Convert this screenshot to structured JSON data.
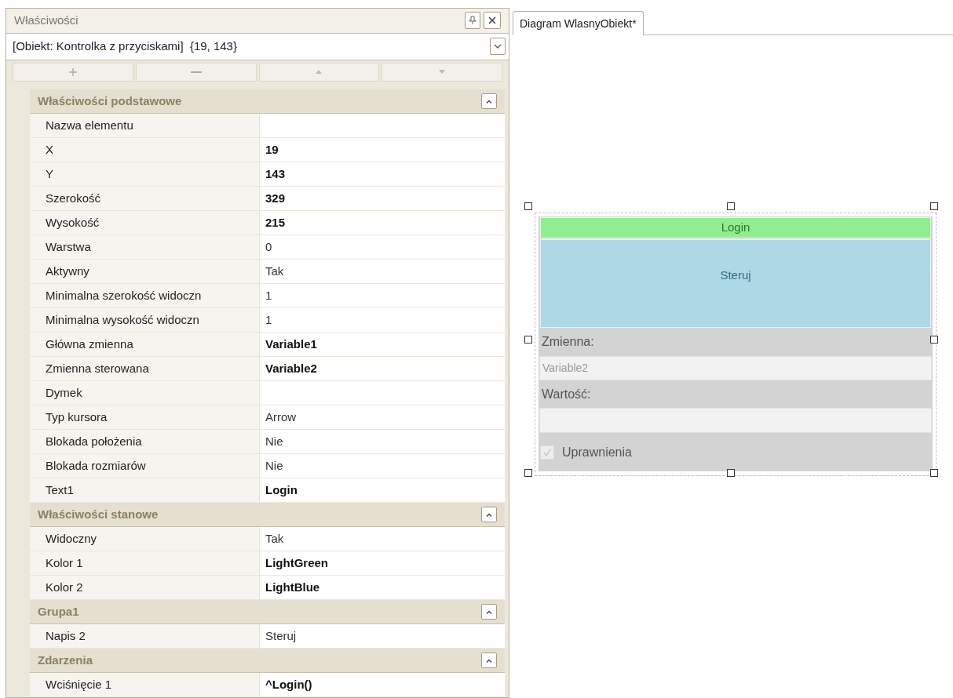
{
  "properties_panel": {
    "title": "Właściwości",
    "object_selector": "[Obiekt: Kontrolka z przyciskami]  {19, 143}",
    "sections": [
      {
        "title": "Właściwości podstawowe",
        "expanded": true,
        "rows": [
          {
            "name": "Nazwa elementu"
          },
          {
            "name": "X",
            "value": "19",
            "bold": true
          },
          {
            "name": "Y",
            "value": "143",
            "bold": true
          },
          {
            "name": "Szerokość",
            "value": "329",
            "bold": true
          },
          {
            "name": "Wysokość",
            "value": "215",
            "bold": true
          },
          {
            "name": "Warstwa",
            "value": "0",
            "bold": false
          },
          {
            "name": "Aktywny",
            "value": "Tak",
            "bold": false
          },
          {
            "name": "Minimalna szerokość widoczn",
            "value": "1",
            "bold": false
          },
          {
            "name": "Minimalna wysokość widoczn",
            "value": "1",
            "bold": false
          },
          {
            "name": "Główna zmienna",
            "value": "Variable1",
            "bold": true
          },
          {
            "name": "Zmienna sterowana",
            "value": "Variable2",
            "bold": true
          },
          {
            "name": "Dymek"
          },
          {
            "name": "Typ kursora",
            "value": "Arrow",
            "bold": false
          },
          {
            "name": "Blokada położenia",
            "value": "Nie",
            "bold": false
          },
          {
            "name": "Blokada rozmiarów",
            "value": "Nie",
            "bold": false
          },
          {
            "name": "Text1",
            "value": "Login",
            "bold": true
          }
        ]
      },
      {
        "title": "Właściwości stanowe",
        "expanded": true,
        "rows": [
          {
            "name": "Widoczny",
            "value": "Tak",
            "bold": false
          },
          {
            "name": "Kolor 1",
            "value": "LightGreen",
            "bold": true
          },
          {
            "name": "Kolor 2",
            "value": "LightBlue",
            "bold": true
          }
        ]
      },
      {
        "title": "Grupa1",
        "expanded": true,
        "rows": [
          {
            "name": "Napis 2",
            "value": "Steruj",
            "bold": false
          }
        ]
      },
      {
        "title": "Zdarzenia",
        "expanded": true,
        "rows": [
          {
            "name": "Wciśnięcie 1",
            "value": "^Login()",
            "bold": true
          }
        ]
      }
    ]
  },
  "tabs": [
    {
      "label": "Diagram WlasnyObiekt*",
      "selected": true
    }
  ],
  "control": {
    "header": "Login",
    "button": "Steruj",
    "variable_label": "Zmienna:",
    "variable_value": "Variable2",
    "value_label": "Wartość:",
    "checkbox": {
      "label": "Uprawnienia",
      "checked": true
    }
  }
}
